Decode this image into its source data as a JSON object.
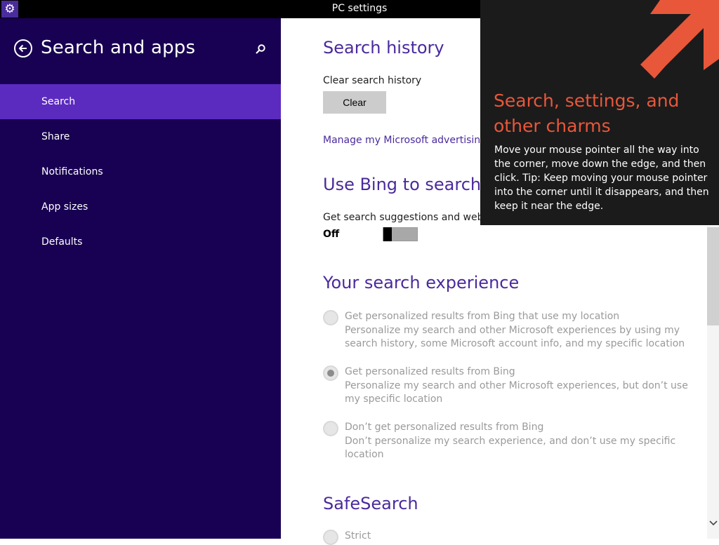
{
  "window": {
    "title": "PC settings"
  },
  "sidebar": {
    "title": "Search and apps",
    "items": [
      {
        "label": "Search",
        "selected": true
      },
      {
        "label": "Share",
        "selected": false
      },
      {
        "label": "Notifications",
        "selected": false
      },
      {
        "label": "App sizes",
        "selected": false
      },
      {
        "label": "Defaults",
        "selected": false
      }
    ]
  },
  "search_history": {
    "heading": "Search history",
    "clear_label": "Clear search history",
    "clear_button": "Clear",
    "advertising_link": "Manage my Microsoft advertising"
  },
  "bing": {
    "heading": "Use Bing to search o",
    "suggestions_label": "Get search suggestions and web res",
    "toggle_state": "Off",
    "toggle_on": false
  },
  "experience": {
    "heading": "Your search experience",
    "options": [
      {
        "title": "Get personalized results from Bing that use my location",
        "desc": "Personalize my search and other Microsoft experiences by using my search history, some Microsoft account info, and my specific location",
        "checked": false
      },
      {
        "title": "Get personalized results from Bing",
        "desc": "Personalize my search and other Microsoft experiences, but don’t use my specific location",
        "checked": true
      },
      {
        "title": "Don’t get personalized results from Bing",
        "desc": "Don’t personalize my search experience, and don’t use my specific location",
        "checked": false
      }
    ]
  },
  "safesearch": {
    "heading": "SafeSearch",
    "first_option": "Strict"
  },
  "charm_tip": {
    "title": "Search, settings, and other charms",
    "body": "Move your mouse pointer all the way into the corner, move down the edge, and then click. Tip: Keep moving your mouse pointer into the corner until it disappears, and then keep it near the edge."
  },
  "icons": {
    "app": "gear-icon",
    "back": "back-arrow-icon",
    "search": "search-icon",
    "tip_arrow": "diagonal-arrow-icon",
    "scroll_down": "chevron-down-icon"
  },
  "colors": {
    "sidebar_bg": "#180052",
    "sidebar_selected": "#5b2bbf",
    "heading": "#4a2a9c",
    "tip_title": "#e8573a",
    "tip_bg": "#1b1b1b"
  }
}
